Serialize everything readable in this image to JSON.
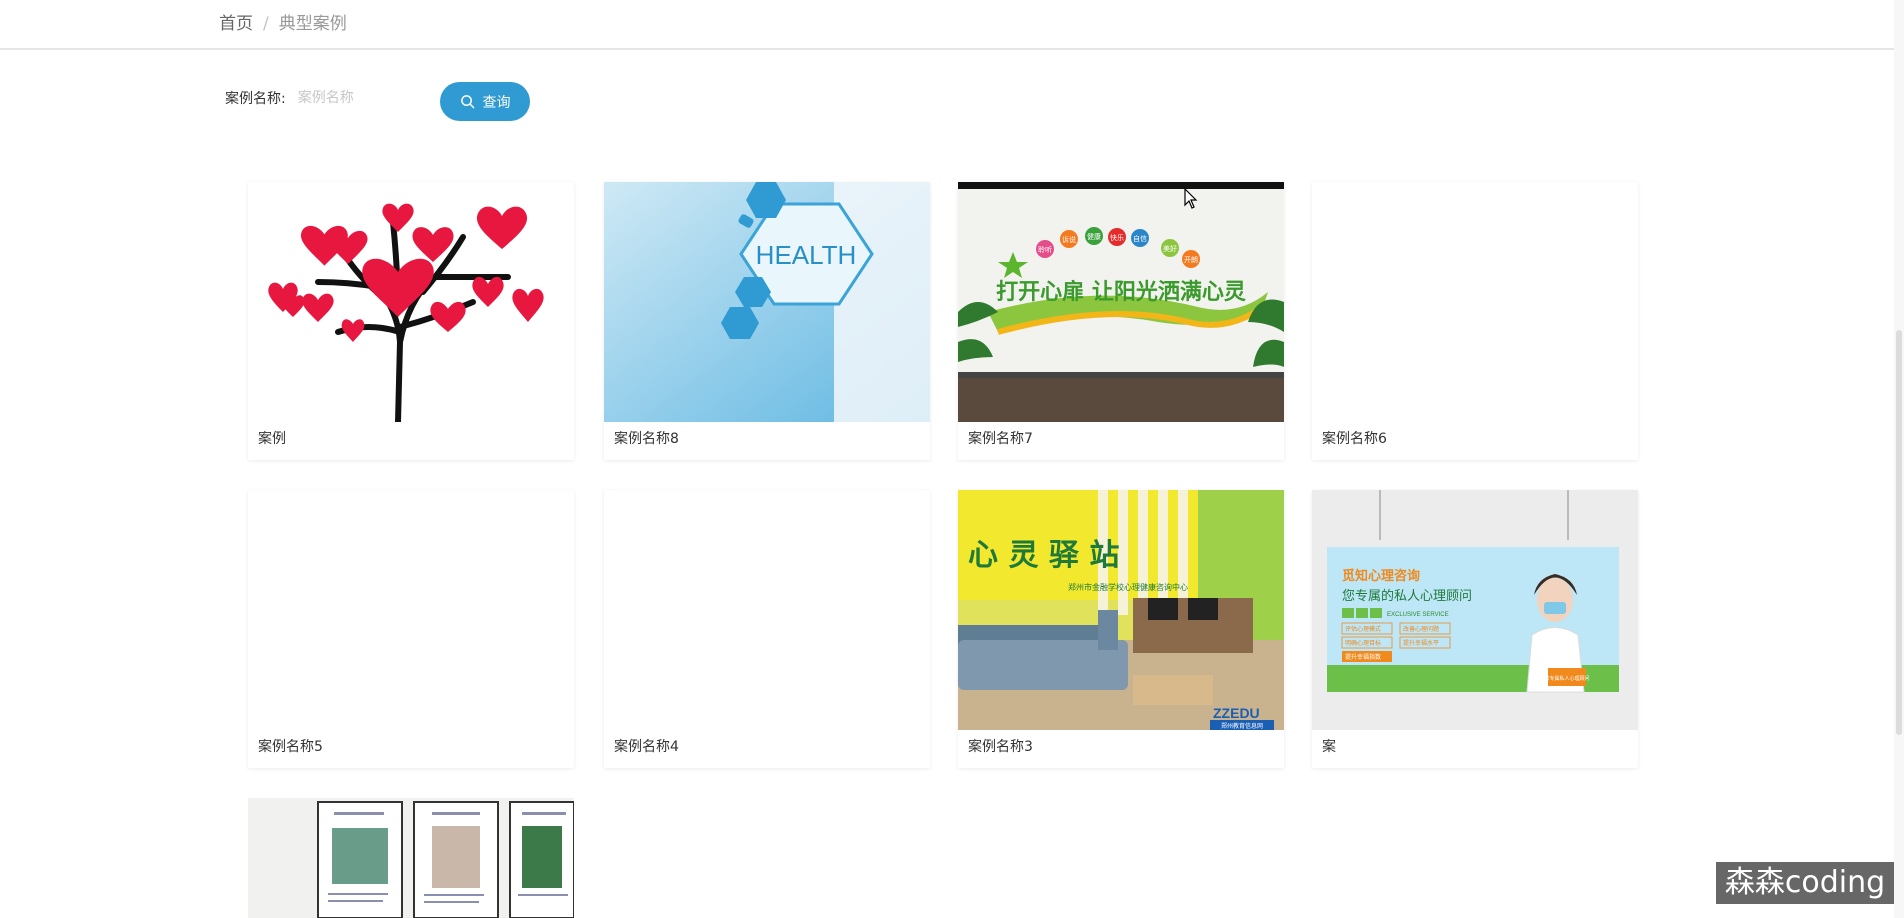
{
  "breadcrumb": {
    "home": "首页",
    "separator": "/",
    "current": "典型案例"
  },
  "search": {
    "label": "案例名称:",
    "placeholder": "案例名称",
    "button_label": "查询"
  },
  "cards": [
    {
      "title": "案例"
    },
    {
      "title": "案例名称8",
      "image_text": "HEALTH"
    },
    {
      "title": "案例名称7",
      "image_text": "打开心扉 让阳光洒满心灵",
      "bubbles": [
        "聆听",
        "诉说",
        "健康",
        "快乐",
        "自信",
        "美好",
        "开朗"
      ]
    },
    {
      "title": "案例名称6"
    },
    {
      "title": "案例名称5"
    },
    {
      "title": "案例名称4"
    },
    {
      "title": "案例名称3",
      "image_text": "心 灵 驿 站",
      "image_subtext": "郑州市金融学校心理健康咨询中心",
      "image_logo": "ZZEDU",
      "image_caption": "郑州教育信息网"
    },
    {
      "title": "案",
      "image_text": "觅知心理咨询",
      "image_subtext": "您专属的私人心理顾问",
      "image_tag": "EXCLUSIVE SERVICE",
      "image_items": [
        "评估心理模式",
        "改善心理问题",
        "明确心理目标",
        "提升幸福水平",
        "提升幸福指数"
      ],
      "image_badge": "您专属私人心理顾问"
    },
    {
      "title": ""
    }
  ],
  "watermark": "森森coding",
  "colors": {
    "accent": "#2f9bd2",
    "heart": "#e8173f",
    "green": "#5bb52d"
  },
  "icons": {
    "search": "search-icon",
    "cursor": "mouse-cursor-icon"
  }
}
